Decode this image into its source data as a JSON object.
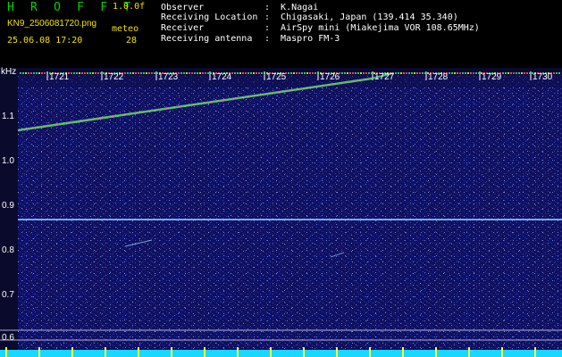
{
  "header": {
    "title": "H R O F F T",
    "version": "1.0.0f",
    "filename": "KN9_2506081720.png",
    "meteor_label": "meteo",
    "datetime": "25.06.08 17:20",
    "meteor_count": "28"
  },
  "info": [
    {
      "label": "Observer",
      "value": ":  K.Nagai"
    },
    {
      "label": "Receiving Location",
      "value": ":  Chigasaki, Japan (139.414 35.340)"
    },
    {
      "label": "Receiver",
      "value": ":  AirSpy mini (Miakejima VOR 108.65MHz)"
    },
    {
      "label": "Receiving antenna",
      "value": ":  Maspro FM-3"
    }
  ],
  "axis": {
    "y_unit": "kHz",
    "y_ticks": [
      "1.1",
      "1.0",
      "0.9",
      "0.8",
      "0.7",
      "0.6"
    ],
    "x_ticks": [
      "1721",
      "1722",
      "1723",
      "1724",
      "1725",
      "1726",
      "1727",
      "1728",
      "1729",
      "1730"
    ]
  },
  "colors": {
    "background": "#000000",
    "title": "#00d200",
    "meta": "#f0e000",
    "info": "#ffffff",
    "waterfall": "#0a0a2c"
  }
}
